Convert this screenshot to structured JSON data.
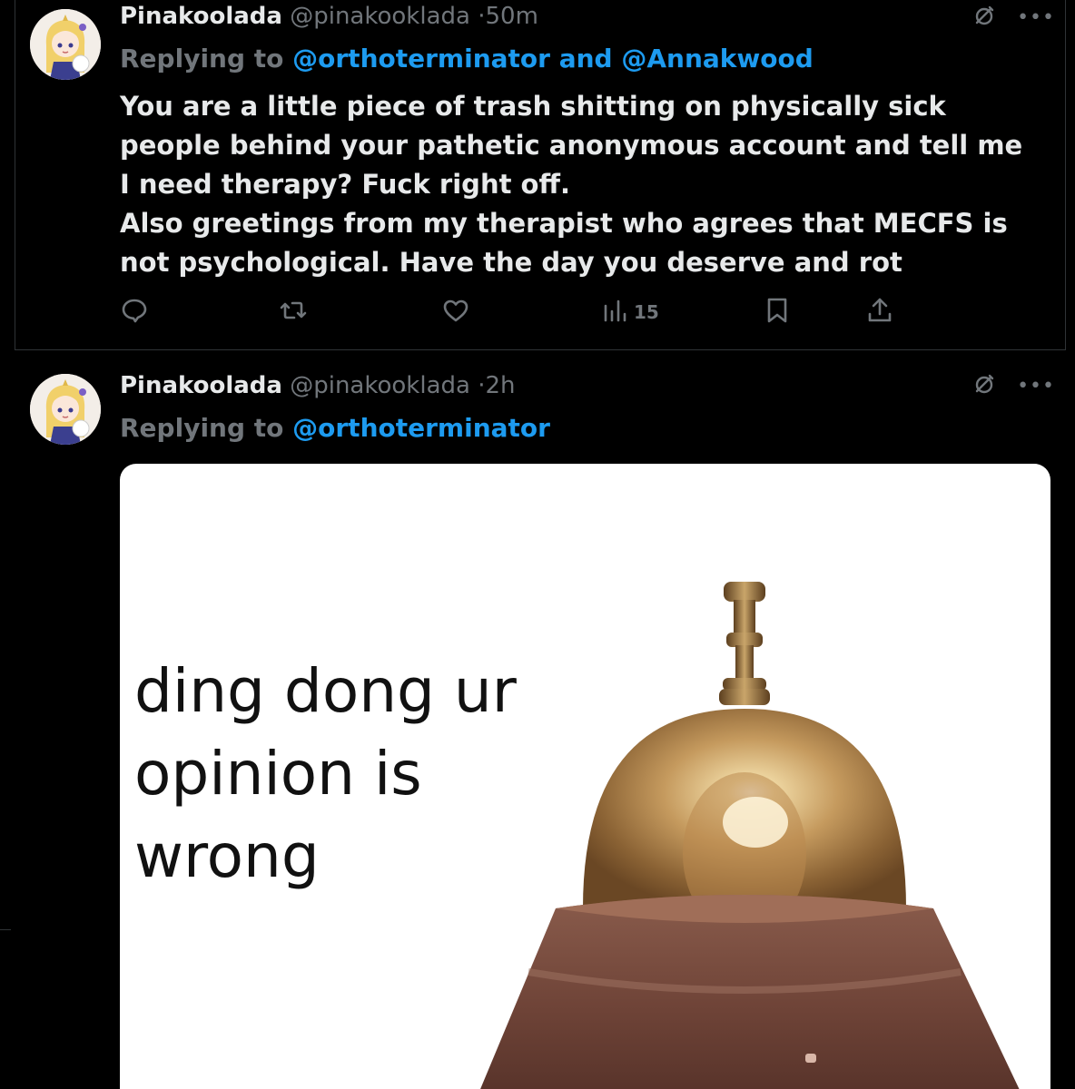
{
  "tweets": [
    {
      "name": "Pinakoolada",
      "handle": "@pinakooklada",
      "separator": "·",
      "time": "50m",
      "replying_prefix": "Replying to",
      "mention_1": "@orthoterminator",
      "mention_joiner": "and",
      "mention_2": "@Annakwood",
      "body_lines": [
        "You are a little piece of trash shitting on physically sick people behind your pathetic anonymous account and tell me I need therapy? Fuck right off.",
        "Also greetings from my therapist who agrees that MECFS is not psychological. Have the day you deserve and rot"
      ],
      "views": "15",
      "icons": [
        "grok-icon",
        "more-icon",
        "reply-icon",
        "retweet-icon",
        "like-icon",
        "views-icon",
        "bookmark-icon",
        "share-icon"
      ]
    },
    {
      "name": "Pinakoolada",
      "handle": "@pinakooklada",
      "separator": "·",
      "time": "2h",
      "replying_prefix": "Replying to",
      "mention_1": "@orthoterminator",
      "meme_lines": [
        "ding dong ur",
        "opinion is",
        "wrong"
      ],
      "icons": [
        "grok-icon",
        "more-icon",
        "service-bell-image"
      ]
    }
  ],
  "colors": {
    "background": "#000000",
    "text": "#e7e9ea",
    "secondary": "#71767b",
    "accent": "#1d9bf0",
    "border": "#2f3336"
  }
}
